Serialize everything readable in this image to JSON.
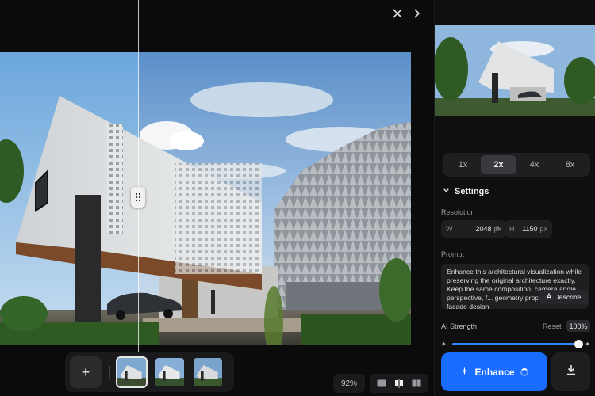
{
  "canvas": {
    "zoom_label": "92%"
  },
  "icons": {
    "close": "close-icon",
    "next": "chevron-right-icon",
    "add": "plus-icon",
    "enhance": "sparkle-icon",
    "download": "download-icon",
    "describe": "describe-icon"
  },
  "thumbnails": [
    {
      "label": "variant-1",
      "active": true
    },
    {
      "label": "variant-2",
      "active": false
    },
    {
      "label": "variant-3",
      "active": false
    }
  ],
  "toolbar": {
    "add_label": "+"
  },
  "panel": {
    "scale_options": [
      "1x",
      "2x",
      "4x",
      "8x"
    ],
    "scale_selected": "2x",
    "settings_title": "Settings",
    "resolution_label": "Resolution",
    "width": {
      "prefix": "W",
      "value": "2048",
      "unit": "px"
    },
    "height": {
      "prefix": "H",
      "value": "1150",
      "unit": "px"
    },
    "times_symbol": "×",
    "prompt_label": "Prompt",
    "prompt_text": "Enhance this architectural visualization while preserving the original architecture exactly. Keep the same composition, camera angle, perspective, f... geometry proportions, facade design",
    "describe_label": "Describe",
    "strength_label": "AI Strength",
    "reset_label": "Reset",
    "strength_value": "100%",
    "strength_level": 1.0,
    "enhance_label": "Enhance"
  },
  "colors": {
    "accent": "#1a6bff",
    "slider_fill": "#2f86ff",
    "panel_bg": "#0f0f10"
  }
}
